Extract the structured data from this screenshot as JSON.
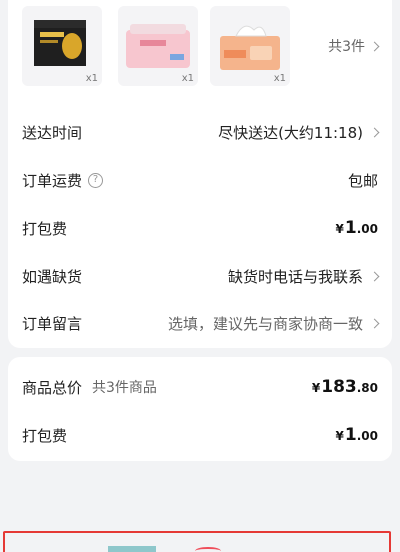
{
  "products": {
    "items": [
      {
        "name": "durian-box-icon",
        "qty": "x1"
      },
      {
        "name": "tissue-pack-icon",
        "qty": "x1"
      },
      {
        "name": "tissue-box-icon",
        "qty": "x1"
      }
    ],
    "count_label": "共3件"
  },
  "order": {
    "delivery_time": {
      "label": "送达时间",
      "value": "尽快送达(大约11:18)"
    },
    "shipping": {
      "label": "订单运费",
      "value": "包邮"
    },
    "packing": {
      "label": "打包费",
      "currency": "¥",
      "int": "1",
      "dec": ".00"
    },
    "out_of_stock": {
      "label": "如遇缺货",
      "value": "缺货时电话与我联系"
    },
    "note": {
      "label": "订单留言",
      "placeholder": "选填，建议先与商家协商一致"
    }
  },
  "summary": {
    "total": {
      "label": "商品总价",
      "sub": "共3件商品",
      "currency": "¥",
      "int": "183",
      "dec": ".80"
    },
    "packing": {
      "label": "打包费",
      "currency": "¥",
      "int": "1",
      "dec": ".00"
    }
  },
  "colors": {
    "accent_red": "#e53935",
    "muted": "#666666"
  }
}
